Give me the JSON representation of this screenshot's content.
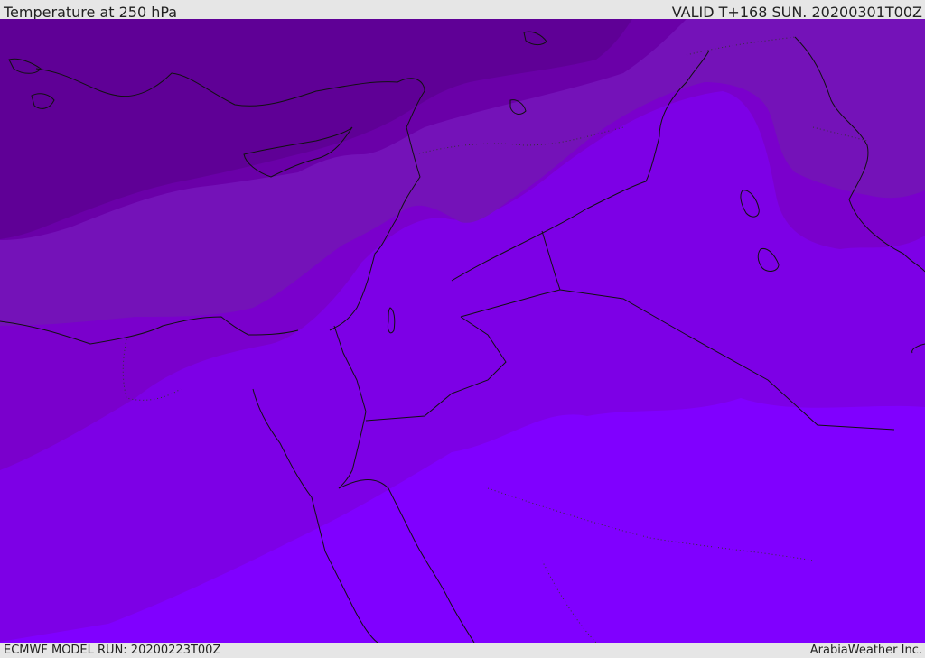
{
  "header": {
    "title": "Temperature at 250 hPa",
    "valid": "VALID T+168 SUN. 20200301T00Z"
  },
  "footer": {
    "model_run": "ECMWF MODEL RUN: 20200223T00Z",
    "credit": "ArabiaWeather Inc."
  },
  "map": {
    "field": "temperature-250hPa",
    "colors": {
      "band_coldest": "#5f0096",
      "band_cold": "#6a00a8",
      "band_mid": "#7412b8",
      "band_warmer": "#7a00cc",
      "band_warm": "#7d00e6",
      "band_warmest": "#8000ff",
      "coastline": "#111111",
      "border_dotted": "#333333"
    }
  }
}
